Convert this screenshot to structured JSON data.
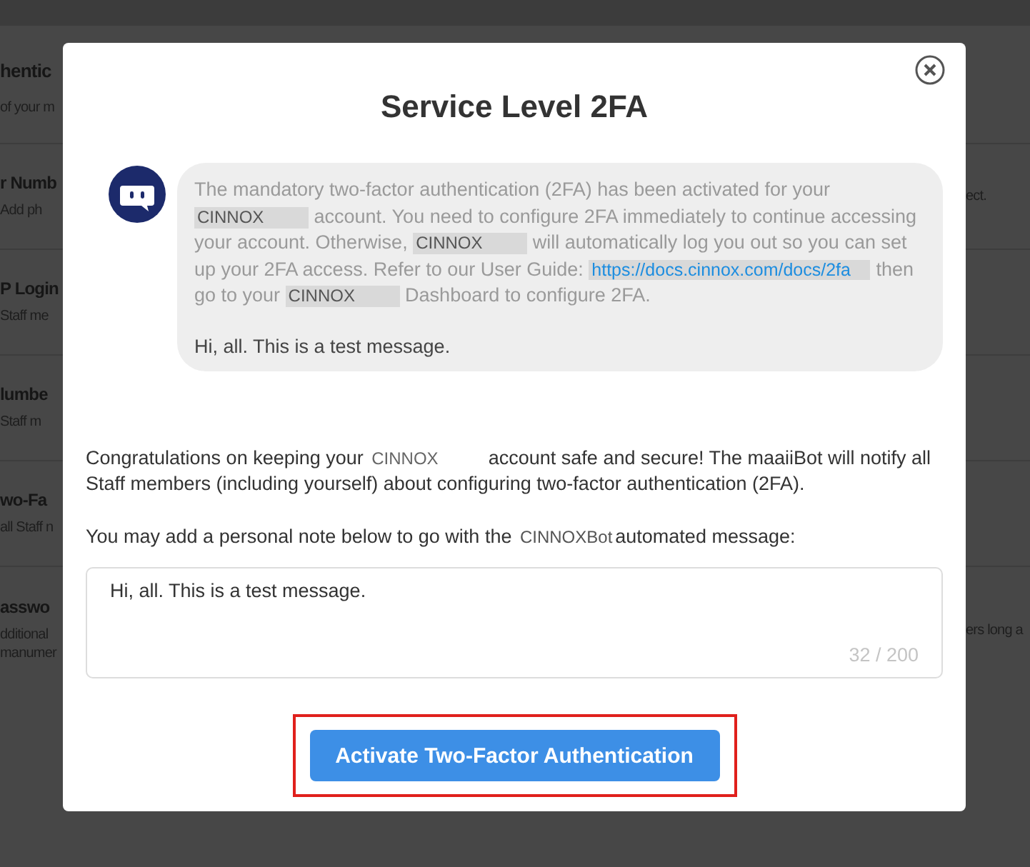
{
  "background": {
    "rows": [
      {
        "title": "hentic",
        "subtitle": [
          "of your m"
        ]
      },
      {
        "title": "r Numb",
        "subtitle": [
          "Add ph"
        ],
        "right_text": "ect."
      },
      {
        "title": "P Login",
        "subtitle": [
          "Staff me"
        ]
      },
      {
        "title": "lumbe",
        "subtitle": [
          "Staff m"
        ]
      },
      {
        "title": "wo-Fa",
        "subtitle": [
          "all Staff n"
        ]
      },
      {
        "title": "asswo",
        "subtitle": [
          "dditional",
          "manumer"
        ],
        "right_text": "ers long a"
      }
    ]
  },
  "dialog": {
    "title": "Service Level 2FA",
    "bot_message": {
      "segments": [
        {
          "kind": "text",
          "text": "The mandatory two-factor authentication (2FA) has been activated for your "
        },
        {
          "kind": "tag",
          "text": "CINNOX"
        },
        {
          "kind": "text",
          "text": " account. You need to configure 2FA immediately to continue accessing your account. Otherwise, "
        },
        {
          "kind": "tag",
          "text": "CINNOX"
        },
        {
          "kind": "text",
          "text": " will automatically log you out so you can set up your 2FA access. Refer to our User Guide: "
        },
        {
          "kind": "link",
          "text": "https://docs.cinnox.com/docs/2fa"
        },
        {
          "kind": "text",
          "text": " then go to your "
        },
        {
          "kind": "tag",
          "text": "CINNOX"
        },
        {
          "kind": "text",
          "text": " Dashboard to configure 2FA."
        }
      ],
      "note": "Hi, all. This is a test message."
    },
    "intro": [
      {
        "kind": "text",
        "text": "Congratulations on keeping your "
      },
      {
        "kind": "tag",
        "text": "CINNOX"
      },
      {
        "kind": "text",
        "text": " account safe and secure! The maaiiBot will notify all Staff members (including yourself) about configuring two-factor authentication (2FA)."
      }
    ],
    "prompt": [
      {
        "kind": "text",
        "text": "You may add a personal note below to go with the "
      },
      {
        "kind": "tag",
        "text": "CINNOXBot"
      },
      {
        "kind": "text",
        "text": "automated message:"
      }
    ],
    "note_field": {
      "value": "Hi, all. This is a test message.",
      "counter": "32 / 200"
    },
    "button": {
      "label": "Activate Two-Factor Authentication",
      "highlighted": true
    }
  }
}
